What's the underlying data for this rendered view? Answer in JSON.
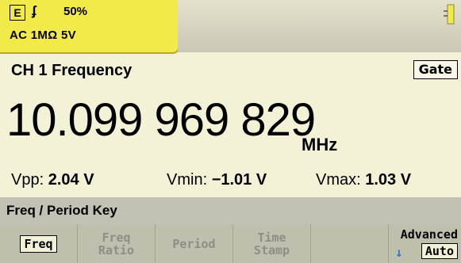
{
  "status": {
    "e_badge": "E",
    "edge_symbol": "ʄ",
    "percent": "50%",
    "config": "AC 1MΩ  5V"
  },
  "measurement": {
    "title": "CH 1 Frequency",
    "gate_label": "Gate",
    "value": "10.099 969 829",
    "unit": "MHz"
  },
  "stats": {
    "vpp_label": "Vpp:",
    "vpp_value": "2.04 V",
    "vmin_label": "Vmin:",
    "vmin_value": "−1.01 V",
    "vmax_label": "Vmax:",
    "vmax_value": "1.03 V"
  },
  "menu": {
    "title": "Freq / Period Key"
  },
  "softkeys": [
    {
      "line1": "Freq",
      "line2": ""
    },
    {
      "line1": "Freq",
      "line2": "Ratio"
    },
    {
      "line1": "Period",
      "line2": ""
    },
    {
      "line1": "Time",
      "line2": "Stamp"
    },
    {
      "line1": "",
      "line2": ""
    },
    {
      "line1": "Advanced",
      "line2": "Auto"
    }
  ]
}
